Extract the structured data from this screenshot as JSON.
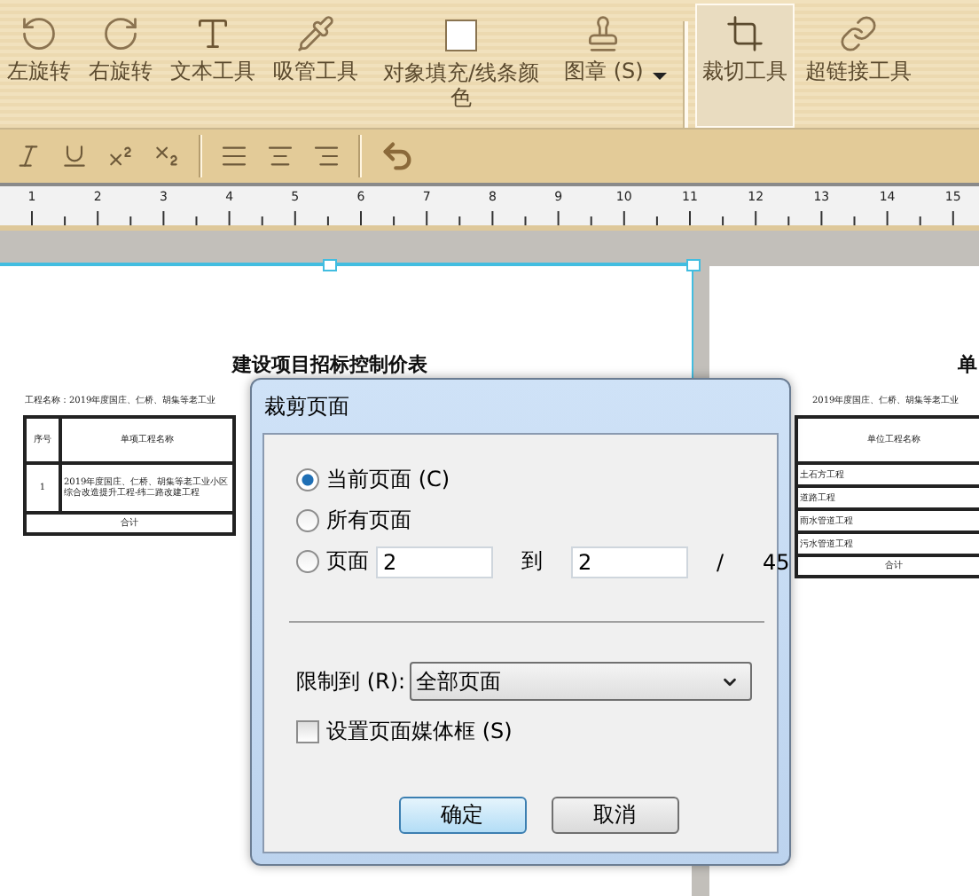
{
  "toolbar": [
    {
      "kind": "rotate-left",
      "label": "左旋转",
      "selected": false
    },
    {
      "kind": "rotate-right",
      "label": "右旋转",
      "selected": false
    },
    {
      "kind": "text",
      "label": "文本工具",
      "selected": false
    },
    {
      "kind": "pipette",
      "label": "吸管工具",
      "selected": false
    },
    {
      "kind": "fill",
      "label": "对象填充/线条颜色",
      "selected": false
    },
    {
      "kind": "stamp",
      "label": "图章 (S)",
      "selected": false,
      "dropdown": true
    },
    {
      "kind": "crop",
      "label": "裁切工具",
      "selected": true
    },
    {
      "kind": "link",
      "label": "超链接工具",
      "selected": false
    }
  ],
  "format_bar": [
    {
      "kind": "italic"
    },
    {
      "kind": "underline"
    },
    {
      "kind": "superscript"
    },
    {
      "kind": "subscript"
    },
    {
      "kind": "sep"
    },
    {
      "kind": "align-left"
    },
    {
      "kind": "align-center"
    },
    {
      "kind": "align-right"
    },
    {
      "kind": "sep"
    },
    {
      "kind": "undo"
    }
  ],
  "ruler_marks": [
    "1",
    "2",
    "3",
    "4",
    "5",
    "6",
    "7",
    "8",
    "9",
    "10",
    "11",
    "12",
    "13",
    "14",
    "15"
  ],
  "left_page": {
    "title": "建设项目招标控制价表",
    "project": "工程名称：2019年度国庄、仁桥、胡集等老工业",
    "header": [
      "序号",
      "单项工程名称"
    ],
    "rows": [
      [
        "1",
        "2019年度国庄、仁桥、胡集等老工业小区综合改造提升工程-纬二路改建工程"
      ]
    ],
    "total": "合计"
  },
  "right_page": {
    "title": "单",
    "project": "2019年度国庄、仁桥、胡集等老工业",
    "header": "单位工程名称",
    "rows": [
      "土石方工程",
      "道路工程",
      "雨水管道工程",
      "污水管道工程"
    ],
    "total": "合计"
  },
  "dialog": {
    "title": "裁剪页面",
    "options": [
      {
        "label": "当前页面 (C)",
        "selected": true
      },
      {
        "label": "所有页面",
        "selected": false
      },
      {
        "label": "页面",
        "selected": false
      }
    ],
    "from": "2",
    "to_label": "到",
    "to": "2",
    "slash": "/",
    "total": "45",
    "limit_label": "限制到 (R):",
    "limit_value": "全部页面",
    "media_box": {
      "label": "设置页面媒体框 (S)",
      "checked": false
    },
    "buttons": [
      {
        "label": "确定",
        "default": true
      },
      {
        "label": "取消",
        "default": false
      }
    ]
  }
}
